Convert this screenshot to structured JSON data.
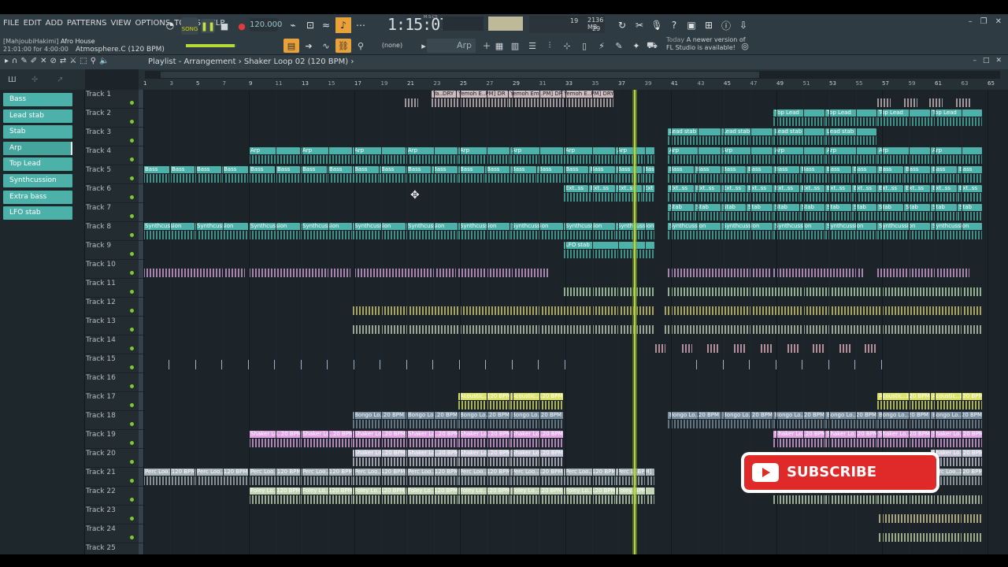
{
  "menu": [
    "FILE",
    "EDIT",
    "ADD",
    "PATTERNS",
    "VIEW",
    "OPTIONS",
    "TOOLS",
    "HELP"
  ],
  "transport": {
    "song_label": "SONG",
    "pat_label": "PAT",
    "tempo": "120.000",
    "time": "1:15:07",
    "time_label": "M:S:CS"
  },
  "cpu": {
    "memory": "2136 MB",
    "poly": "19",
    "cpu": "29"
  },
  "project": {
    "author": "[MahjoubiHakimi]",
    "genre": "Afro House",
    "position": "21:01:00 for 4:00:00",
    "channel": "Atmosphere.C (120 BPM)"
  },
  "pattern_select": "(none)",
  "arp_select": "Arp",
  "news": {
    "date": "Today",
    "line1": "A newer version of",
    "line2": "FL Studio is available!"
  },
  "playlist": {
    "title": "Playlist - Arrangement › Shaker Loop 02 (120 BPM) ›"
  },
  "picker": [
    "Bass",
    "Lead stab",
    "Stab",
    "Arp",
    "Top Lead",
    "Synthcussion",
    "Extra bass",
    "LFO stab"
  ],
  "tracks": [
    "Track 1",
    "Track 2",
    "Track 3",
    "Track 4",
    "Track 5",
    "Track 6",
    "Track 7",
    "Track 8",
    "Track 9",
    "Track 10",
    "Track 11",
    "Track 12",
    "Track 13",
    "Track 14",
    "Track 15",
    "Track 16",
    "Track 17",
    "Track 18",
    "Track 19",
    "Track 20",
    "Track 21",
    "Track 22",
    "Track 23",
    "Track 24",
    "Track 25"
  ],
  "bars": [
    "1",
    "3",
    "5",
    "7",
    "9",
    "11",
    "13",
    "15",
    "17",
    "19",
    "21",
    "23",
    "25",
    "27",
    "29",
    "31",
    "33",
    "35",
    "37",
    "39",
    "41",
    "43",
    "45",
    "47",
    "49",
    "51",
    "53",
    "55",
    "57",
    "59",
    "61",
    "63",
    "65"
  ],
  "clip_rows": [
    {
      "track": 1,
      "color": "#cdbcbf",
      "text": "#222222",
      "clips": [
        [
          338,
          356,
          ""
        ],
        [
          372,
          404,
          "Ya..DRY"
        ],
        [
          404,
          470,
          "Yemoh E..PM] DR"
        ],
        [
          470,
          538,
          "Yemoh Em..PM] DRY"
        ],
        [
          538,
          604,
          "Yemoh E..PM] DRY"
        ],
        [
          938,
          956,
          ""
        ],
        [
          972,
          990,
          ""
        ],
        [
          1004,
          1022,
          ""
        ],
        [
          1038,
          1058,
          ""
        ]
      ]
    },
    {
      "track": 2,
      "color": "#4cb1a8",
      "text": "#ffffff",
      "clips": [
        [
          806,
          872,
          "Top Lead"
        ],
        [
          872,
          938,
          "Top Lead"
        ],
        [
          938,
          1006,
          "Top Lead"
        ],
        [
          1006,
          1072,
          "Top Lead"
        ]
      ]
    },
    {
      "track": 3,
      "color": "#4cb1a8",
      "text": "#ffffff",
      "clips": [
        [
          672,
          740,
          "Lead stab"
        ],
        [
          740,
          806,
          "Lead stab"
        ],
        [
          806,
          872,
          "Lead stab"
        ],
        [
          872,
          938,
          "Lead stab"
        ]
      ]
    },
    {
      "track": 4,
      "color": "#4cb1a8",
      "text": "#ffffff",
      "clips": [
        [
          140,
          206,
          "Arp"
        ],
        [
          206,
          272,
          "Arp"
        ],
        [
          272,
          340,
          "Arp"
        ],
        [
          340,
          406,
          "Arp"
        ],
        [
          406,
          472,
          "Arp"
        ],
        [
          472,
          540,
          "Arp"
        ],
        [
          540,
          606,
          "Arp"
        ],
        [
          606,
          656,
          "Arp"
        ],
        [
          672,
          740,
          "Arp"
        ],
        [
          740,
          806,
          "Arp"
        ],
        [
          806,
          872,
          "Arp"
        ],
        [
          872,
          938,
          "Arp"
        ],
        [
          938,
          1006,
          "Arp"
        ],
        [
          1006,
          1072,
          "Arp"
        ]
      ]
    },
    {
      "track": 5,
      "color": "#4cb1a8",
      "text": "#ffffff",
      "clips": [
        [
          6,
          40,
          "Bass"
        ],
        [
          40,
          72,
          "Bass"
        ],
        [
          72,
          106,
          "Bass"
        ],
        [
          106,
          140,
          "Bass"
        ],
        [
          140,
          174,
          "Bass"
        ],
        [
          174,
          206,
          "Bass"
        ],
        [
          206,
          240,
          "Bass"
        ],
        [
          240,
          272,
          "Bass"
        ],
        [
          272,
          306,
          "Bass"
        ],
        [
          306,
          340,
          "Bass"
        ],
        [
          340,
          372,
          "Bass"
        ],
        [
          372,
          406,
          "Bass"
        ],
        [
          406,
          440,
          "Bass"
        ],
        [
          440,
          472,
          "Bass"
        ],
        [
          472,
          506,
          "Bass"
        ],
        [
          506,
          540,
          "Bass"
        ],
        [
          540,
          572,
          "Bass"
        ],
        [
          572,
          606,
          "Bass"
        ],
        [
          606,
          640,
          "Bass"
        ],
        [
          640,
          656,
          "Bass"
        ],
        [
          672,
          706,
          "Bass"
        ],
        [
          706,
          740,
          "Bass"
        ],
        [
          740,
          772,
          "Bass"
        ],
        [
          772,
          806,
          "Bass"
        ],
        [
          806,
          840,
          "Bass"
        ],
        [
          840,
          872,
          "Bass"
        ],
        [
          872,
          906,
          "Bass"
        ],
        [
          906,
          938,
          "Bass"
        ],
        [
          938,
          972,
          "Bass"
        ],
        [
          972,
          1006,
          "Bass"
        ],
        [
          1006,
          1040,
          "Bass"
        ],
        [
          1040,
          1072,
          "Bass"
        ]
      ]
    },
    {
      "track": 6,
      "color": "#4cb1a8",
      "text": "#ffffff",
      "clips": [
        [
          540,
          572,
          "Ext..ss"
        ],
        [
          572,
          606,
          "Ext..ss"
        ],
        [
          606,
          640,
          "Ext..ss"
        ],
        [
          640,
          656,
          "Ext"
        ],
        [
          672,
          706,
          "Ext..ss"
        ],
        [
          706,
          740,
          "Ext..ss"
        ],
        [
          740,
          772,
          "Ext..ss"
        ],
        [
          772,
          806,
          "Ext..ss"
        ],
        [
          806,
          840,
          "Ext..ss"
        ],
        [
          840,
          872,
          "Ext..ss"
        ],
        [
          872,
          906,
          "Ext..ss"
        ],
        [
          906,
          938,
          "Ext..ss"
        ],
        [
          938,
          972,
          "Ext..ss"
        ],
        [
          972,
          1006,
          "Ext..ss"
        ],
        [
          1006,
          1040,
          "Ext..ss"
        ],
        [
          1040,
          1072,
          "Ext..ss"
        ]
      ]
    },
    {
      "track": 7,
      "color": "#4cb1a8",
      "text": "#ffffff",
      "clips": [
        [
          672,
          706,
          "Stab"
        ],
        [
          706,
          740,
          "Stab"
        ],
        [
          740,
          772,
          "Stab"
        ],
        [
          772,
          806,
          "Stab"
        ],
        [
          806,
          840,
          "Stab"
        ],
        [
          840,
          872,
          "Stab"
        ],
        [
          872,
          906,
          "Stab"
        ],
        [
          906,
          938,
          "Stab"
        ],
        [
          938,
          972,
          "Stab"
        ],
        [
          972,
          1006,
          "Stab"
        ],
        [
          1006,
          1040,
          "Stab"
        ],
        [
          1040,
          1072,
          "Stab"
        ]
      ]
    },
    {
      "track": 8,
      "color": "#4cb1a8",
      "text": "#ffffff",
      "clips": [
        [
          6,
          72,
          "Synthcussion"
        ],
        [
          72,
          140,
          "Synthcussion"
        ],
        [
          140,
          206,
          "Synthcussion"
        ],
        [
          206,
          272,
          "Synthcussion"
        ],
        [
          272,
          340,
          "Synthcussion"
        ],
        [
          340,
          406,
          "Synthcussion"
        ],
        [
          406,
          472,
          "Synthcussion"
        ],
        [
          472,
          540,
          "Synthcussion"
        ],
        [
          540,
          606,
          "Synthcussion"
        ],
        [
          606,
          656,
          "Synthcussion"
        ],
        [
          672,
          740,
          "Synthcussion"
        ],
        [
          740,
          806,
          "Synthcussion"
        ],
        [
          806,
          872,
          "Synthcussion"
        ],
        [
          872,
          938,
          "Synthcussion"
        ],
        [
          938,
          1006,
          "Synthcussion"
        ],
        [
          1006,
          1072,
          "Synthcussion"
        ]
      ]
    },
    {
      "track": 9,
      "color": "#4cb1a8",
      "text": "#ffffff",
      "clips": [
        [
          540,
          656,
          "LFO stab"
        ]
      ]
    },
    {
      "track": 10,
      "color": "#d6a5dc",
      "text": "#222222",
      "clips": [
        [
          6,
          136,
          ""
        ],
        [
          140,
          270,
          ""
        ],
        [
          274,
          404,
          ""
        ],
        [
          406,
          522,
          ""
        ],
        [
          672,
          804,
          ""
        ],
        [
          806,
          922,
          ""
        ],
        [
          938,
          1056,
          ""
        ]
      ]
    },
    {
      "track": 11,
      "color": "#b8e0b2",
      "text": "#222222",
      "clips": [
        [
          540,
          656,
          ""
        ],
        [
          672,
          1072,
          ""
        ]
      ]
    },
    {
      "track": 12,
      "color": "#d4cf76",
      "text": "#222222",
      "clips": [
        [
          272,
          656,
          ""
        ],
        [
          668,
          1072,
          ""
        ]
      ]
    },
    {
      "track": 13,
      "color": "#c3d1b8",
      "text": "#222222",
      "clips": [
        [
          272,
          656,
          ""
        ],
        [
          668,
          1072,
          ""
        ]
      ]
    },
    {
      "track": 14,
      "color": "#e4b0c0",
      "text": "#222222",
      "clips": [
        [
          656,
          670,
          ""
        ],
        [
          690,
          704,
          ""
        ],
        [
          722,
          738,
          ""
        ],
        [
          756,
          772,
          ""
        ],
        [
          790,
          806,
          ""
        ],
        [
          824,
          840,
          ""
        ],
        [
          856,
          872,
          ""
        ],
        [
          890,
          906,
          ""
        ],
        [
          922,
          938,
          ""
        ]
      ]
    },
    {
      "track": 17,
      "color": "#dbe36a",
      "text": "#ffffff",
      "clips": [
        [
          406,
          472,
          "Acoustic..120 BPM"
        ],
        [
          472,
          540,
          "Acoustic..120 BPM"
        ],
        [
          938,
          1006,
          "Acoustic..120 BPM"
        ],
        [
          1006,
          1072,
          "Acoustic..120 BPM"
        ]
      ]
    },
    {
      "track": 18,
      "color": "#7a8fa0",
      "text": "#ffffff",
      "clips": [
        [
          272,
          340,
          "Bongo Lo..20 BPM"
        ],
        [
          340,
          406,
          "Bongo Lo..20 BPM"
        ],
        [
          406,
          472,
          "Bongo Lo..20 BPM"
        ],
        [
          472,
          540,
          "Bongo Lo..20 BPM"
        ],
        [
          672,
          740,
          "Bongo Lo..20 BPM"
        ],
        [
          740,
          806,
          "Bongo Lo..20 BPM"
        ],
        [
          806,
          872,
          "Bongo Lo..20 BPM"
        ],
        [
          872,
          938,
          "Bongo Lo..20 BPM"
        ],
        [
          938,
          1006,
          "Bongo Lo..20 BPM"
        ],
        [
          1006,
          1072,
          "Bongo Lo..20 BPM"
        ]
      ]
    },
    {
      "track": 19,
      "color": "#e0a6e6",
      "text": "#ffffff",
      "clips": [
        [
          140,
          206,
          "Shaker Lo..20 BPM"
        ],
        [
          206,
          272,
          "Shaker Lo..20 BPM"
        ],
        [
          272,
          340,
          "Shaker Lo..20 BPM"
        ],
        [
          340,
          406,
          "Shaker Lo..20 BPM"
        ],
        [
          406,
          472,
          "Shaker Lo..20 BPM"
        ],
        [
          472,
          540,
          "Shaker Lo..20 BPM"
        ],
        [
          806,
          872,
          "Shaker Lo..20 BPM"
        ],
        [
          872,
          938,
          "Shaker Lo..20 BPM"
        ],
        [
          938,
          1006,
          "Shaker Lo..20 BPM"
        ],
        [
          1006,
          1072,
          "Shaker Lo..20 BPM"
        ]
      ]
    },
    {
      "track": 20,
      "color": "#c6c6d8",
      "text": "#ffffff",
      "clips": [
        [
          272,
          340,
          "Shaker Lo..20 BPM"
        ],
        [
          340,
          406,
          "Shaker Lo..20 BPM"
        ],
        [
          406,
          472,
          "Shaker Lo..20 BPM"
        ],
        [
          472,
          540,
          "Shaker Lo..20 BPM"
        ],
        [
          1006,
          1072,
          "Shaker Lo..20 BPM"
        ]
      ]
    },
    {
      "track": 21,
      "color": "#a7b4bc",
      "text": "#ffffff",
      "clips": [
        [
          6,
          72,
          "Perc Loo..120 BPM"
        ],
        [
          72,
          140,
          "Perc Loo..120 BPM"
        ],
        [
          140,
          206,
          "Perc Loo..120 BPM"
        ],
        [
          206,
          272,
          "Perc Loo..120 BPM"
        ],
        [
          272,
          340,
          "Perc Loo..120 BPM"
        ],
        [
          340,
          406,
          "Perc Loo..120 BPM"
        ],
        [
          406,
          472,
          "Perc Loo..120 BPM"
        ],
        [
          472,
          540,
          "Perc Loo..120 BPM"
        ],
        [
          540,
          606,
          "Perc Loo..120 BPM"
        ],
        [
          606,
          656,
          "Perc L..BPM]"
        ],
        [
          1006,
          1072,
          "Perc Loo..120 BPM"
        ]
      ]
    },
    {
      "track": 22,
      "color": "#c4d8b8",
      "text": "#ffffff",
      "clips": [
        [
          140,
          206,
          "Foley Lo..120 BPM"
        ],
        [
          206,
          272,
          "Foley Lo..120 BPM"
        ],
        [
          272,
          340,
          "Foley Lo..120 BPM"
        ],
        [
          340,
          406,
          "Foley Lo..120 BPM"
        ],
        [
          406,
          472,
          "Foley Lo..120 BPM"
        ],
        [
          472,
          540,
          "Foley Lo..120 BPM"
        ],
        [
          540,
          606,
          "Foley Lo..120 BPM"
        ],
        [
          606,
          656,
          "Foley..BPM"
        ],
        [
          806,
          872,
          ""
        ],
        [
          872,
          938,
          ""
        ],
        [
          938,
          1006,
          ""
        ],
        [
          1006,
          1072,
          ""
        ]
      ]
    },
    {
      "track": 23,
      "color": "#d6d09a",
      "text": "#222222",
      "clips": [
        [
          940,
          1072,
          ""
        ]
      ]
    },
    {
      "track": 24,
      "color": "#c6d8a8",
      "text": "#222222",
      "clips": [
        [
          940,
          1072,
          ""
        ]
      ]
    },
    {
      "track": 15,
      "color": "#7a8fa8",
      "text": "#222222",
      "clips": []
    }
  ],
  "overlay": {
    "subscribe": "SUBSCRIBE"
  }
}
